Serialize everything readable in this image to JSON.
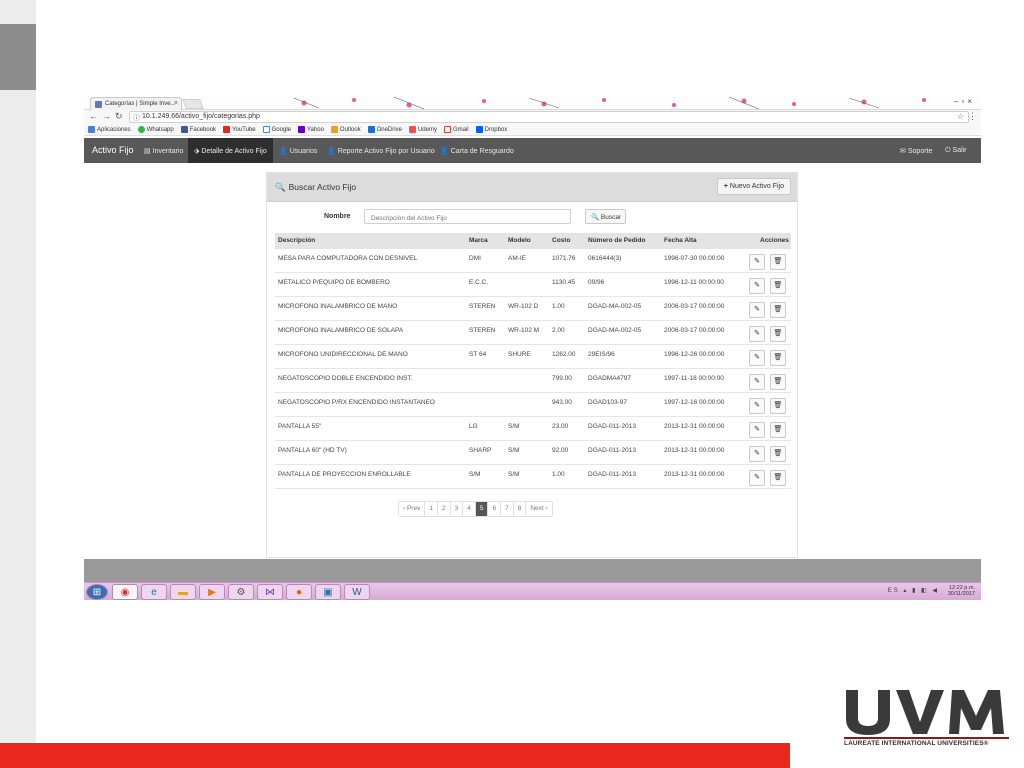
{
  "browser": {
    "tab_title": "Categorías | Simple Inve...",
    "tab_close": "×",
    "url": "10.1.249.66/activo_fijo/categorias.php",
    "bookmarks": [
      "Aplicaciones",
      "Whatsapp",
      "Facebook",
      "YouTube",
      "Google",
      "Yahoo",
      "Outlook",
      "OneDrive",
      "Udemy",
      "Gmail",
      "Dropbox"
    ]
  },
  "navbar": {
    "brand": "Activo Fijo",
    "items": [
      {
        "label": "Inventario",
        "icon": "list-icon"
      },
      {
        "label": "Detalle de Activo Fijo",
        "icon": "tags-icon",
        "active": true
      },
      {
        "label": "Usuarios",
        "icon": "user-icon"
      },
      {
        "label": "Reporte Activo Fijo por Usuario",
        "icon": "user-icon"
      },
      {
        "label": "Carta de Resguardo",
        "icon": "user-icon"
      }
    ],
    "right": [
      {
        "label": "Soporte",
        "icon": "envelope-icon"
      },
      {
        "label": "Salir",
        "icon": "power-icon"
      }
    ]
  },
  "panel": {
    "title": "Buscar Activo Fijo",
    "new_button": "Nuevo Activo Fijo",
    "filter_label": "Nombre",
    "filter_placeholder": "Descripción del Activo Fijo",
    "search_button": "Buscar"
  },
  "table": {
    "headers": [
      "Descripción",
      "Marca",
      "Modelo",
      "Costo",
      "Número de Pedido",
      "Fecha Alta",
      "Acciones"
    ],
    "rows": [
      {
        "descripcion": "MESA PARA COMPUTADORA CON DESNIVEL",
        "marca": "DMI",
        "modelo": "AM-IE",
        "costo": "1071.76",
        "pedido": "0616444(3)",
        "fecha": "1996-07-30 00:00:00"
      },
      {
        "descripcion": "METALICO P/EQUIPO DE BOMBERO",
        "marca": "E.C.C.",
        "modelo": "",
        "costo": "1130.45",
        "pedido": "09/96",
        "fecha": "1996-12-11 00:00:00"
      },
      {
        "descripcion": "MICROFONO INALAMBRICO DE MANO",
        "marca": "STEREN",
        "modelo": "WR-102 D",
        "costo": "1.00",
        "pedido": "DGAD-MA-002-05",
        "fecha": "2006-03-17 00:00:00"
      },
      {
        "descripcion": "MICROFONO INALAMBRICO DE SOLAPA",
        "marca": "STEREN",
        "modelo": "WR-102 M",
        "costo": "2.00",
        "pedido": "DGAD-MA-002-05",
        "fecha": "2006-03-17 00:00:00"
      },
      {
        "descripcion": "MICROFONO UNIDIRECCIONAL DE MANO",
        "marca": "ST 64",
        "modelo": "SHURE",
        "costo": "1262.00",
        "pedido": "29EIS/96",
        "fecha": "1996-12-26 00:00:00"
      },
      {
        "descripcion": "NEGATOSCOPIO DOBLE ENCENDIDO INST.",
        "marca": "",
        "modelo": "",
        "costo": "799.00",
        "pedido": "DGADMA4797",
        "fecha": "1997-11-18 00:00:00"
      },
      {
        "descripcion": "NEGATOSCOPIO P/RX ENCENDIDO INSTANTANEO",
        "marca": "",
        "modelo": "",
        "costo": "943.00",
        "pedido": "DGAD103-97",
        "fecha": "1997-12-16 00:00:00"
      },
      {
        "descripcion": "PANTALLA 55\"",
        "marca": "LG",
        "modelo": "S/M",
        "costo": "23.00",
        "pedido": "DGAD-011-2013",
        "fecha": "2013-12-31 00:00:00"
      },
      {
        "descripcion": "PANTALLA 60\" (HD TV)",
        "marca": "SHARP",
        "modelo": "S/M",
        "costo": "92.00",
        "pedido": "DGAD-011-2013",
        "fecha": "2013-12-31 00:00:00"
      },
      {
        "descripcion": "PANTALLA DE PROYECCIÓN ENROLLABLE",
        "marca": "S/M",
        "modelo": "S/M",
        "costo": "1.00",
        "pedido": "DGAD-011-2013",
        "fecha": "2013-12-31 00:00:00"
      }
    ]
  },
  "pagination": {
    "prev": "‹ Prev",
    "pages": [
      "1",
      "2",
      "3",
      "4",
      "5",
      "6",
      "7",
      "8"
    ],
    "active": "5",
    "next": "Next ›"
  },
  "taskbar": {
    "lang": "ES",
    "time": "12:22 p.m.",
    "date": "30/11/2017",
    "apps": [
      "windows-start-icon",
      "chrome-icon",
      "ie-icon",
      "folder-icon",
      "media-player-icon",
      "network-icon",
      "visual-studio-icon",
      "firefox-icon",
      "remote-desktop-icon",
      "word-icon"
    ]
  },
  "logo": {
    "letters": "UVM",
    "tagline": "LAUREATE INTERNATIONAL UNIVERSITIES",
    "tagline_mark": "®",
    "color": "#3a3a3a",
    "accent": "#8b1a1a"
  }
}
